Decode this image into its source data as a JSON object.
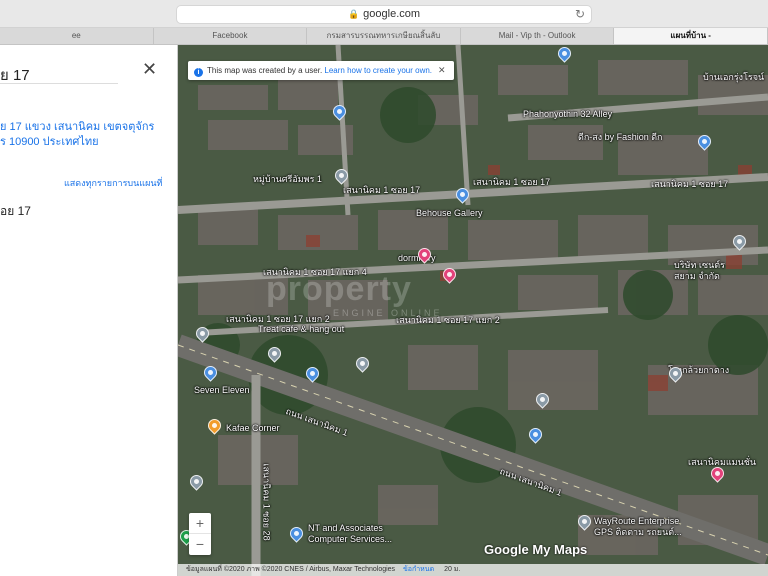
{
  "browser": {
    "url": "google.com",
    "tabs": [
      {
        "label": "ee",
        "active": false
      },
      {
        "label": "Facebook",
        "active": false
      },
      {
        "label": "กรมสารบรรณทหารเกษียณสิ้นลับ",
        "active": false
      },
      {
        "label": "Mail - Vip th - Outlook",
        "active": false
      },
      {
        "label": "แผนที่บ้าน -",
        "active": true
      }
    ]
  },
  "panel": {
    "title": "ย 17",
    "address": "ย 17 แขวง เสนานิคม เขตจตุจักร\nร 10900 ประเทศไทย",
    "all_items_link": "แสดงทุกรายการบนแผนที่",
    "street_label": "อย 17"
  },
  "map": {
    "notice_text": "This map was created by a user.",
    "notice_link": "Learn how to create your own.",
    "labels": {
      "phahonyothin32": "Phahonyothin 32 Alley",
      "soi17_top_a": "เสนานิคม 1 ซอย 17",
      "soi17_top_b": "เสนานิคม 1 ซอย 17",
      "soi17_top_c": "เสนานิคม 1 ซอย 17",
      "soi17_yaek4": "เสนานิคม 1 ซอย 17 แยก 4",
      "soi17_yaek2": "เสนานิคม 1 ซอย 17 แยก 2",
      "soi17_2": "เสนานิคม 1 ซอย 17 แยก 2",
      "behouse": "Behouse Gallery",
      "dormitory": "dormitory",
      "treat": "Treat cafe & hang out",
      "seven": "Seven Eleven",
      "kafae": "Kafae Corner",
      "nt": "NT and Associates\nComputer Services...",
      "wayroute": "WayRoute Enterprise\nGPS ติดตาม รถยนต์...",
      "senanikhom_road_a": "ถนน เสนานิคม 1",
      "senanikhom_road_b": "ถนน เสนานิคม 1",
      "soi28": "เสนานิคม 1 ซอย 28",
      "moo_ban": "หมู่บ้านศรีอัมพร 1",
      "fashion": "ดีก-สง by Fashion ดีก",
      "ban_ake": "บ้านเอกรุ่งโรจน์",
      "senanikhom_mansion": "เสนานิคมแมนชั่น",
      "rong_kluai": "โรงกล้วยกาตาง",
      "brs": "บริษัท เซนต์ร\nสยาม จำกัด"
    },
    "watermark": "property",
    "watermark_sub": "ENGINE ONLINE",
    "logo": "Google My Maps",
    "attribution": "ข้อมูลแผนที่ ©2020 ภาพ ©2020 CNES / Airbus, Maxar Technologies",
    "attribution_link": "ข้อกำหนด",
    "scale": "20 ม."
  }
}
